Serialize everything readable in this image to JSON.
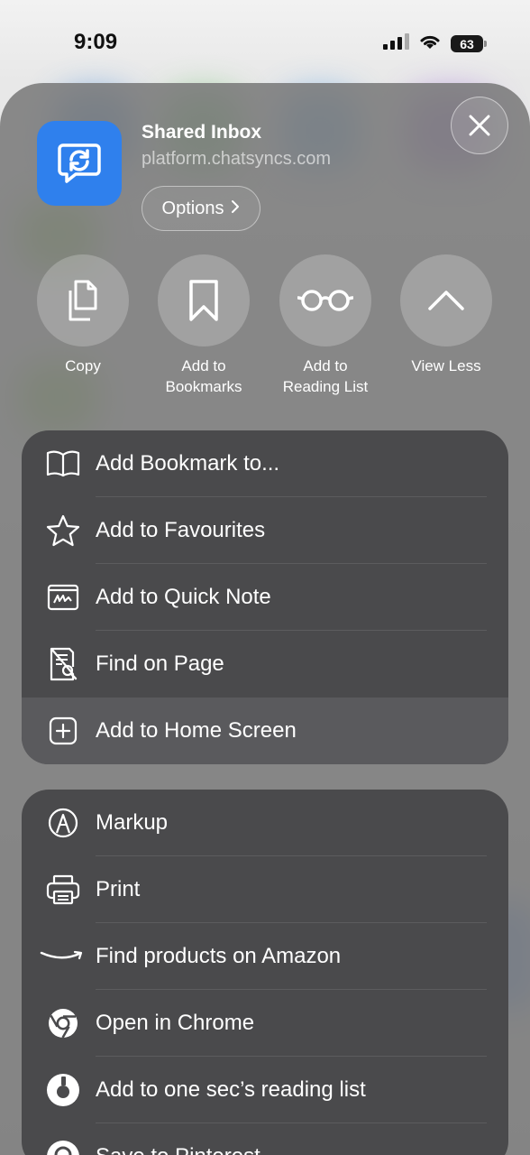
{
  "status": {
    "time": "9:09",
    "battery": "63"
  },
  "header": {
    "title": "Shared Inbox",
    "url": "platform.chatsyncs.com",
    "options_label": "Options"
  },
  "actions": [
    {
      "label": "Copy",
      "icon": "copy-icon"
    },
    {
      "label": "Add to\nBookmarks",
      "icon": "bookmark-icon"
    },
    {
      "label": "Add to\nReading List",
      "icon": "reading-glasses-icon"
    },
    {
      "label": "View Less",
      "icon": "chevron-up-icon"
    }
  ],
  "menu_group1": [
    {
      "label": "Add Bookmark to...",
      "icon": "book-icon"
    },
    {
      "label": "Add to Favourites",
      "icon": "star-icon"
    },
    {
      "label": "Add to Quick Note",
      "icon": "quick-note-icon"
    },
    {
      "label": "Find on Page",
      "icon": "find-on-page-icon"
    },
    {
      "label": "Add to Home Screen",
      "icon": "plus-square-icon",
      "highlighted": true
    }
  ],
  "menu_group2": [
    {
      "label": "Markup",
      "icon": "markup-icon"
    },
    {
      "label": "Print",
      "icon": "printer-icon"
    },
    {
      "label": "Find products on Amazon",
      "icon": "amazon-icon"
    },
    {
      "label": "Open in Chrome",
      "icon": "chrome-icon"
    },
    {
      "label": "Add to one sec’s reading list",
      "icon": "one-sec-icon"
    },
    {
      "label": "Save to Pinterest",
      "icon": "pinterest-icon"
    }
  ],
  "colors": {
    "accent": "#2f80ed",
    "sheet": "#787878",
    "group": "#4a4a4c",
    "highlight": "#5a5a5d"
  }
}
